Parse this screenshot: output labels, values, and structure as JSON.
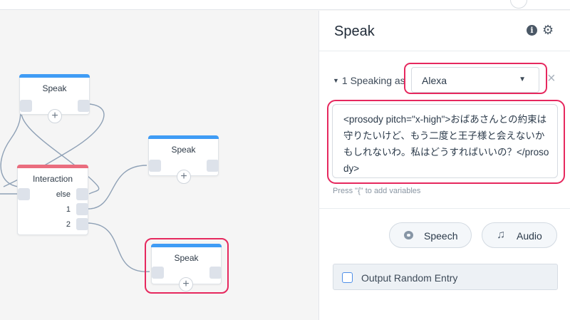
{
  "canvas": {
    "blocks": [
      {
        "title": "Speak",
        "plus": "+"
      },
      {
        "title": "Speak",
        "plus": "+"
      },
      {
        "title": "Speak",
        "plus": "+"
      }
    ],
    "interaction": {
      "title": "Interaction",
      "ports": [
        "else",
        "1",
        "2"
      ]
    }
  },
  "panel": {
    "title": "Speak",
    "info_icon": "i",
    "gear_icon": "⚙",
    "speaking_prefix": "1 Speaking as",
    "voice": "Alexa",
    "close": "×",
    "speech_text": "<prosody pitch=\"x-high\">おばあさんとの約束は守りたいけど、もう二度と王子様と会えないかもしれないわ。私はどうすればいいの？</prosody>",
    "hint": "Press \"{\" to add variables",
    "speech_button": "Speech",
    "audio_button": "Audio",
    "audio_icon": "♫",
    "output_random": "Output Random Entry"
  },
  "colors": {
    "accent_blue": "#3f9cf5",
    "accent_red": "#ea6d7e",
    "highlight": "#e6285e"
  },
  "icons": [
    "info-icon",
    "gear-icon",
    "chevron-down-icon",
    "close-icon",
    "speech-icon",
    "music-note-icon",
    "plus-icon"
  ]
}
